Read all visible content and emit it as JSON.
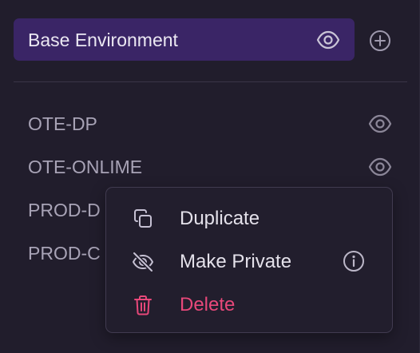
{
  "base_environment": {
    "label": "Base Environment",
    "visibility_icon": "eye-icon",
    "add_icon": "plus-circle-icon"
  },
  "environments": [
    {
      "label": "OTE-DP",
      "icon": "eye-icon"
    },
    {
      "label": "OTE-ONLIME",
      "icon": "eye-icon"
    },
    {
      "label": "PROD-D"
    },
    {
      "label": "PROD-C"
    }
  ],
  "context_menu": {
    "items": [
      {
        "label": "Duplicate",
        "icon": "copy-icon"
      },
      {
        "label": "Make Private",
        "icon": "eye-off-icon",
        "info_icon": "info-icon"
      },
      {
        "label": "Delete",
        "icon": "trash-icon"
      }
    ]
  },
  "colors": {
    "background": "#211d2c",
    "selected_item": "#3a2566",
    "delete_text": "#e8487a",
    "muted_text": "#a8a3b6"
  }
}
